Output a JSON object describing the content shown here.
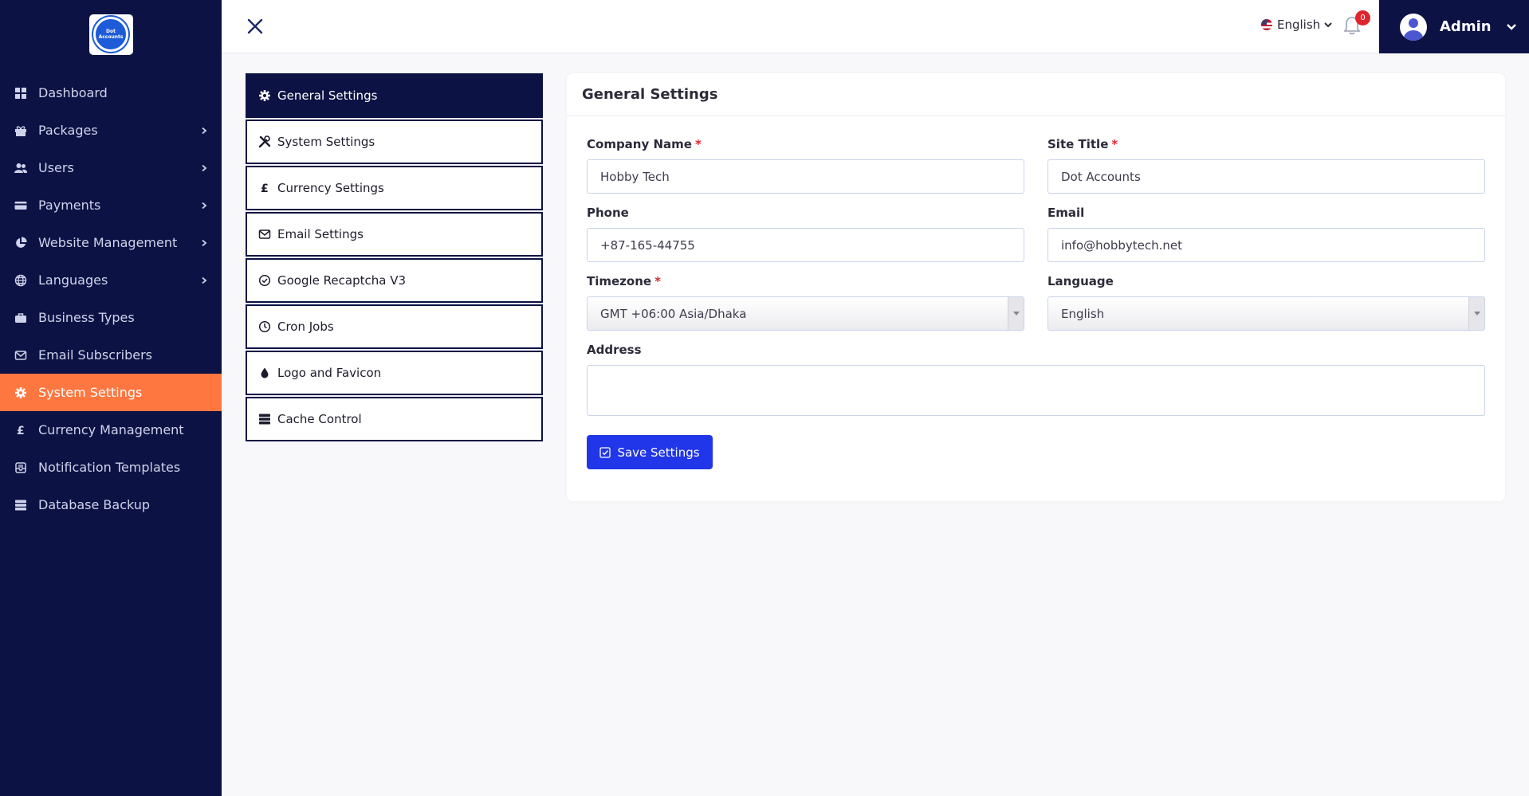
{
  "brand": {
    "logo_text": "Dot Accounts"
  },
  "sidebar": {
    "items": [
      {
        "label": "Dashboard",
        "icon": "dashboard-icon",
        "has_children": false,
        "active": false
      },
      {
        "label": "Packages",
        "icon": "gift-icon",
        "has_children": true,
        "active": false
      },
      {
        "label": "Users",
        "icon": "users-icon",
        "has_children": true,
        "active": false
      },
      {
        "label": "Payments",
        "icon": "credit-card-icon",
        "has_children": true,
        "active": false
      },
      {
        "label": "Website Management",
        "icon": "chart-pie-icon",
        "has_children": true,
        "active": false
      },
      {
        "label": "Languages",
        "icon": "globe-icon",
        "has_children": true,
        "active": false
      },
      {
        "label": "Business Types",
        "icon": "briefcase-icon",
        "has_children": false,
        "active": false
      },
      {
        "label": "Email Subscribers",
        "icon": "envelope-icon",
        "has_children": false,
        "active": false
      },
      {
        "label": "System Settings",
        "icon": "gear-icon",
        "has_children": false,
        "active": true
      },
      {
        "label": "Currency Management",
        "icon": "pound-icon",
        "has_children": false,
        "active": false
      },
      {
        "label": "Notification Templates",
        "icon": "mail-bulk-icon",
        "has_children": false,
        "active": false
      },
      {
        "label": "Database Backup",
        "icon": "database-icon",
        "has_children": false,
        "active": false
      }
    ]
  },
  "topbar": {
    "language": "English",
    "notification_count": "0",
    "user_name": "Admin"
  },
  "tabs": [
    {
      "label": "General Settings",
      "icon": "gear-icon",
      "active": true
    },
    {
      "label": "System Settings",
      "icon": "tools-icon",
      "active": false
    },
    {
      "label": "Currency Settings",
      "icon": "pound-icon",
      "active": false
    },
    {
      "label": "Email Settings",
      "icon": "envelope-icon",
      "active": false
    },
    {
      "label": "Google Recaptcha V3",
      "icon": "check-circle-icon",
      "active": false
    },
    {
      "label": "Cron Jobs",
      "icon": "clock-icon",
      "active": false
    },
    {
      "label": "Logo and Favicon",
      "icon": "droplet-icon",
      "active": false
    },
    {
      "label": "Cache Control",
      "icon": "server-icon",
      "active": false
    }
  ],
  "form": {
    "title": "General Settings",
    "company_name": {
      "label": "Company Name",
      "required_mark": "*",
      "value": "Hobby Tech"
    },
    "site_title": {
      "label": "Site Title",
      "required_mark": "*",
      "value": "Dot Accounts"
    },
    "phone": {
      "label": "Phone",
      "value": "+87-165-44755"
    },
    "email": {
      "label": "Email",
      "value": "info@hobbytech.net"
    },
    "timezone": {
      "label": "Timezone",
      "required_mark": "*",
      "value": "GMT +06:00 Asia/Dhaka"
    },
    "language": {
      "label": "Language",
      "value": "English"
    },
    "address": {
      "label": "Address",
      "value": ""
    },
    "save_label": "Save Settings"
  },
  "colors": {
    "sidebar_bg": "#0c1244",
    "active_nav": "#ff7740",
    "primary_button": "#2136e8",
    "required": "#e0242e"
  }
}
